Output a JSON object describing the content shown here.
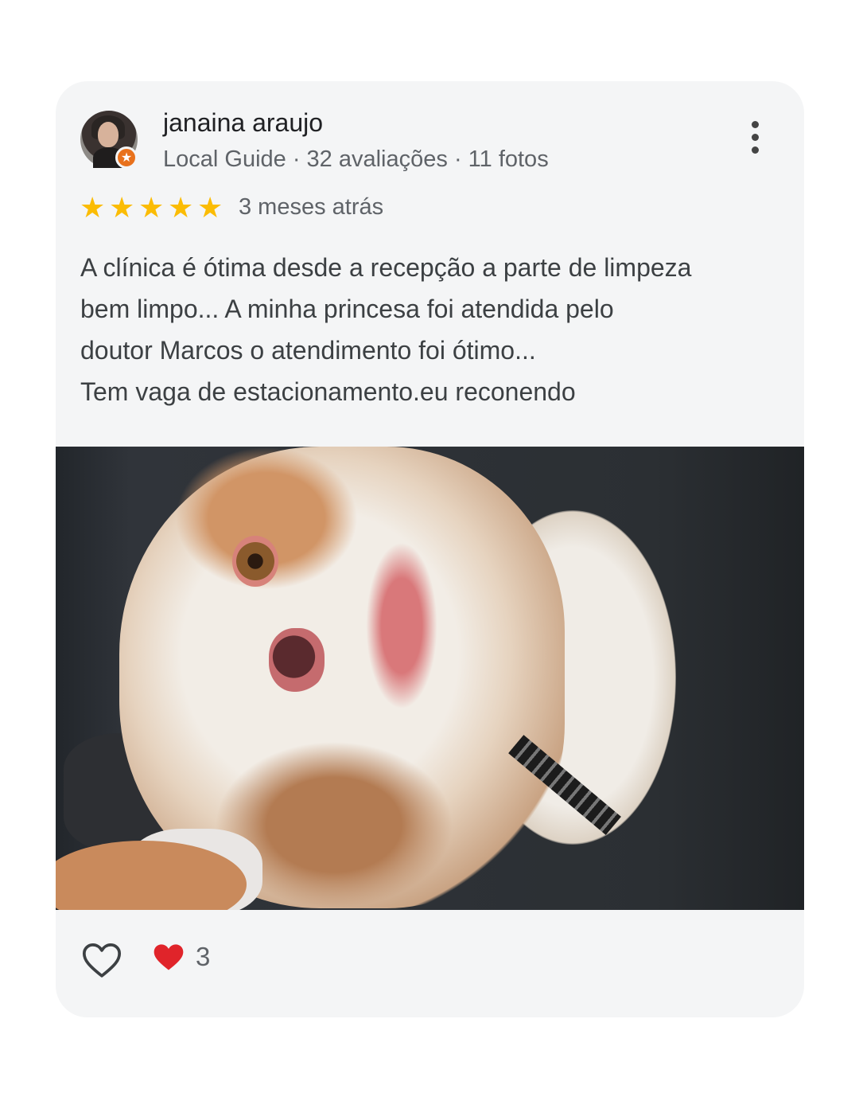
{
  "review": {
    "author_name": "janaina araujo",
    "author_meta": "Local Guide · 32 avaliações · 11 fotos",
    "rating": 5,
    "rating_max": 5,
    "time_ago": "3 meses atrás",
    "text_lines": [
      "A clínica é ótima desde a recepção a parte de limpeza",
      "bem limpo... A minha princesa foi atendida pelo",
      "doutor Marcos o atendimento foi ótimo...",
      "Tem vaga de estacionamento.eu reconendo"
    ],
    "reaction_count": "3"
  },
  "icons": {
    "menu": "more-vert-icon",
    "like": "heart-outline-icon",
    "reaction": "heart-filled-icon",
    "badge": "local-guide-star-icon",
    "star": "star-icon"
  },
  "colors": {
    "star": "#fbbc04",
    "badge": "#e8711c",
    "heart": "#e0242a",
    "card_bg": "#f4f5f6"
  }
}
